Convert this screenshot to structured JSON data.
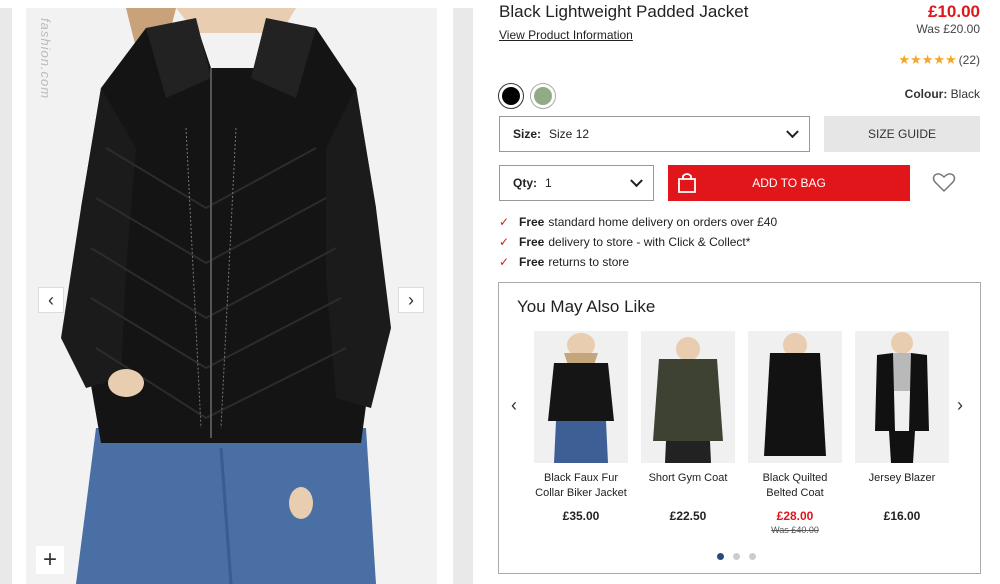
{
  "gallery": {
    "watermark": "fashion.com",
    "prev_label": "‹",
    "next_label": "›",
    "zoom_label": "+"
  },
  "product": {
    "title": "Black Lightweight Padded Jacket",
    "view_info": "View Product Information",
    "price": "£10.00",
    "was": "Was £20.00",
    "rating_stars": 5,
    "rating_count": "(22)",
    "colour_label": "Colour:",
    "colour_value": "Black",
    "swatches": [
      {
        "name": "Black",
        "color": "#000000"
      },
      {
        "name": "Green",
        "color": "#8fac84"
      }
    ],
    "size_label": "Size:",
    "size_value": "Size 12",
    "size_guide": "SIZE GUIDE",
    "qty_label": "Qty:",
    "qty_value": "1",
    "add_to_bag": "ADD TO BAG",
    "accent": "#e0161b"
  },
  "delivery": [
    {
      "bold": "Free",
      "text": "standard home delivery on orders over £40"
    },
    {
      "bold": "Free",
      "text": "delivery to store - with Click & Collect*"
    },
    {
      "bold": "Free",
      "text": "returns to store"
    }
  ],
  "recommendations": {
    "heading": "You May Also Like",
    "items": [
      {
        "name": "Black Faux Fur Collar Biker Jacket",
        "price": "£35.00",
        "was": "",
        "sale": false
      },
      {
        "name": "Short Gym Coat",
        "price": "£22.50",
        "was": "",
        "sale": false
      },
      {
        "name": "Black Quilted Belted Coat",
        "price": "£28.00",
        "was": "Was £40.00",
        "sale": true
      },
      {
        "name": "Jersey Blazer",
        "price": "£16.00",
        "was": "",
        "sale": false
      }
    ],
    "page_count": 3,
    "active_page": 1
  }
}
